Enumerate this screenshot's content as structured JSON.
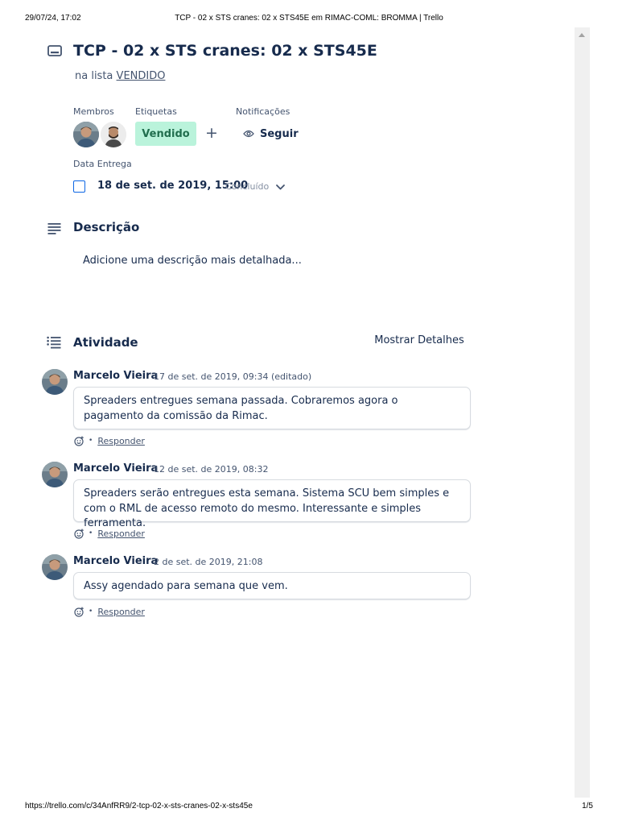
{
  "print": {
    "datetime": "29/07/24, 17:02",
    "page_title": "TCP - 02 x STS cranes: 02 x STS45E em RIMAC-COML: BROMMA | Trello",
    "url": "https://trello.com/c/34AnfRR9/2-tcp-02-x-sts-cranes-02-x-sts45e",
    "page_count": "1/5"
  },
  "card": {
    "icon": "card-icon",
    "title": "TCP - 02 x STS cranes: 02 x STS45E",
    "list_prefix": "na lista",
    "list_name": "VENDIDO"
  },
  "members": {
    "label": "Membros",
    "avatars": [
      "member-avatar-1",
      "member-avatar-2"
    ]
  },
  "labels": {
    "label": "Etiquetas",
    "chip_text": "Vendido",
    "chip_color": "#baf3db",
    "add_symbol": "+"
  },
  "notifications": {
    "label": "Notificações",
    "watch_label": "Seguir",
    "icon": "eye-icon"
  },
  "due": {
    "label": "Data Entrega",
    "date": "18 de set. de 2019, 15:00",
    "status": "Concluído",
    "icon": "chevron-down-icon"
  },
  "description": {
    "title": "Descrição",
    "icon": "description-icon",
    "placeholder": "Adicione uma descrição mais detalhada..."
  },
  "activity": {
    "title": "Atividade",
    "icon": "activity-icon",
    "show_details": "Mostrar Detalhes",
    "comments": [
      {
        "author": "Marcelo Vieira",
        "time": "17 de set. de 2019, 09:34 (editado)",
        "text": "Spreaders entregues semana passada. Cobraremos agora o pagamento da comissão da Rimac.",
        "reply": "Responder"
      },
      {
        "author": "Marcelo Vieira",
        "time": "12 de set. de 2019, 08:32",
        "text": "Spreaders serão entregues esta semana. Sistema SCU bem simples e com o RML de acesso remoto do mesmo. Interessante e simples ferramenta.",
        "reply": "Responder"
      },
      {
        "author": "Marcelo Vieira",
        "time": "2 de set. de 2019, 21:08",
        "text": "Assy agendado para semana que vem.",
        "reply": "Responder"
      }
    ]
  },
  "colors": {
    "text_primary": "#172b4d",
    "text_subtle": "#44546f",
    "checkbox_blue": "#0c66e4",
    "label_green": "#216e4e"
  }
}
